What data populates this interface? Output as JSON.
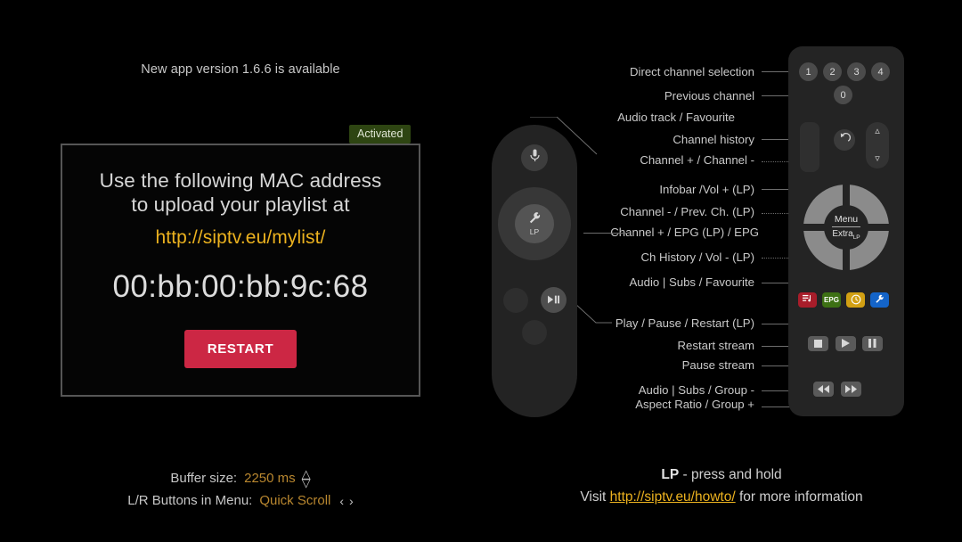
{
  "notice": {
    "text": "New app version 1.6.6 is available"
  },
  "badge": {
    "label": "Activated",
    "color": "#2e4512"
  },
  "mac_panel": {
    "line1": "Use the following MAC address",
    "line2": "to upload your playlist at",
    "url": "http://siptv.eu/mylist/",
    "mac_address": "00:bb:00:bb:9c:68",
    "restart_label": "RESTART",
    "restart_color": "#cc2744"
  },
  "settings": {
    "buffer": {
      "label": "Buffer size:",
      "value": "2250 ms",
      "up_icon": "chevron-up",
      "down_icon": "chevron-down"
    },
    "lr_buttons": {
      "label": "L/R Buttons in Menu:",
      "value": "Quick Scroll",
      "prev_icon": "chevron-left",
      "next_icon": "chevron-right"
    }
  },
  "callouts": {
    "direct_channel_selection": "Direct channel selection",
    "previous_channel": "Previous channel",
    "audio_track_favourite": "Audio track / Favourite",
    "channel_history": "Channel history",
    "channel_plus_minus": "Channel + / Channel -",
    "infobar_vol_plus": "Infobar /Vol + (LP)",
    "channel_minus_prev": "Channel - / Prev. Ch. (LP)",
    "channel_plus_epg": "Channel + / EPG (LP) / EPG",
    "ch_history_vol_minus": "Ch History / Vol - (LP)",
    "audio_subs_favourite": "Audio | Subs / Favourite",
    "play_pause_restart": "Play / Pause / Restart (LP)",
    "restart_stream": "Restart stream",
    "pause_stream": "Pause stream",
    "audio_subs_group_minus": "Audio | Subs / Group -",
    "aspect_ratio_group_plus": "Aspect Ratio / Group +"
  },
  "remote_left": {
    "mic_icon": "microphone-icon",
    "wheel_icon": "wrench-icon",
    "wheel_lp": "LP",
    "playpause_icon": "play-pause-icon"
  },
  "remote_right": {
    "numbers": [
      "1",
      "2",
      "3",
      "4"
    ],
    "zero": "0",
    "back_icon": "back-arrow-icon",
    "rocker_up_icon": "chevron-up-icon",
    "rocker_down_icon": "chevron-down-icon",
    "wheel_menu": "Menu",
    "wheel_extra": "Extra",
    "wheel_extra_sub": "LP",
    "color_buttons": [
      {
        "name": "playlist",
        "label": "",
        "color": "#a81d2a",
        "icon": "playlist-music-icon"
      },
      {
        "name": "epg",
        "label": "EPG",
        "color": "#3d7014",
        "icon": "epg-icon"
      },
      {
        "name": "timer",
        "label": "",
        "color": "#d2a013",
        "icon": "clock-icon"
      },
      {
        "name": "settings",
        "label": "",
        "color": "#1464c8",
        "icon": "wrench-icon"
      }
    ],
    "transport": [
      {
        "name": "stop",
        "icon": "stop-icon"
      },
      {
        "name": "play",
        "icon": "play-icon"
      },
      {
        "name": "pause",
        "icon": "pause-icon"
      }
    ],
    "seek": [
      {
        "name": "rewind",
        "icon": "rewind-icon"
      },
      {
        "name": "forward",
        "icon": "fast-forward-icon"
      }
    ]
  },
  "footer": {
    "lp_abbr": "LP",
    "lp_text": " - press and hold",
    "visit_prefix": "Visit ",
    "link": "http://siptv.eu/howto/",
    "visit_suffix": " for more information"
  }
}
